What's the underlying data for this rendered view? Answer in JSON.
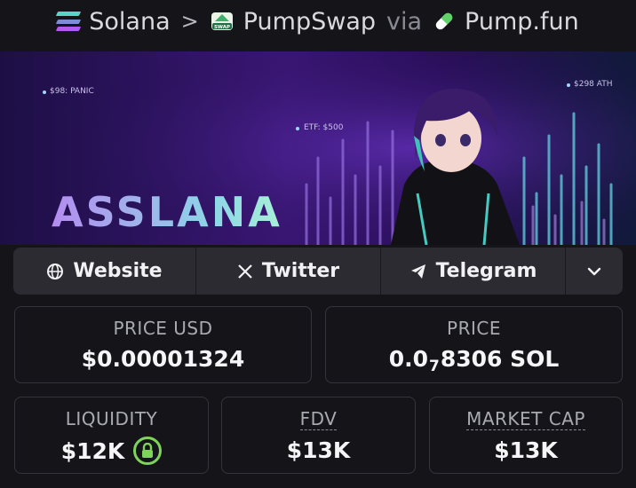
{
  "breadcrumb": {
    "chain": "Solana",
    "separator": ">",
    "dex": "PumpSwap",
    "via": "via",
    "launchpad": "Pump.fun",
    "dex_icon_text": "SWAP"
  },
  "banner": {
    "title": "ASSLANA",
    "tags": [
      "$98: PANIC",
      "ETF: $500",
      "$298 ATH"
    ]
  },
  "links": {
    "website": "Website",
    "twitter": "Twitter",
    "telegram": "Telegram"
  },
  "stats": {
    "price_usd_label": "PRICE USD",
    "price_usd_value": "$0.00001324",
    "price_label": "PRICE",
    "price_value_prefix": "0.0",
    "price_value_sub": "7",
    "price_value_suffix": "8306 SOL",
    "liquidity_label": "LIQUIDITY",
    "liquidity_value": "$12K",
    "fdv_label": "FDV",
    "fdv_value": "$13K",
    "mcap_label": "MARKET CAP",
    "mcap_value": "$13K"
  },
  "colors": {
    "background": "#151519",
    "bar": "#2b2b31",
    "lock_green": "#7fd35a",
    "pumpfun_green": "#5fd36a"
  }
}
